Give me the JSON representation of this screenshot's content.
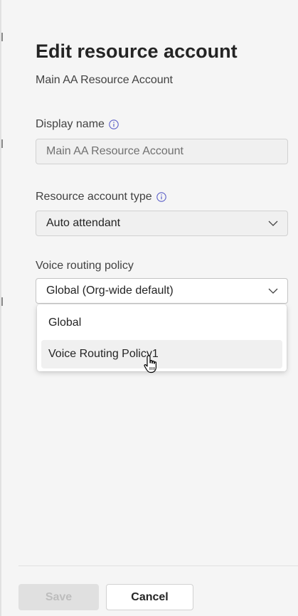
{
  "panel": {
    "title": "Edit resource account",
    "subtitle": "Main AA Resource Account"
  },
  "fields": {
    "display_name": {
      "label": "Display name",
      "value": "Main AA Resource Account",
      "disabled": true
    },
    "resource_account_type": {
      "label": "Resource account type",
      "value": "Auto attendant"
    },
    "voice_routing_policy": {
      "label": "Voice routing policy",
      "value": "Global (Org-wide default)",
      "options": [
        "Global",
        "Voice Routing Policy1"
      ],
      "hovered_option": "Voice Routing Policy1"
    }
  },
  "footer": {
    "save_label": "Save",
    "cancel_label": "Cancel"
  },
  "icons": {
    "info": "info-icon",
    "chevron": "chevron-down-icon",
    "cursor": "hand-pointer-cursor"
  },
  "colors": {
    "background": "#f5f5f5",
    "info_icon": "#5b5fc7",
    "disabled_text": "#707070",
    "save_disabled_bg": "#e0e0e0"
  }
}
